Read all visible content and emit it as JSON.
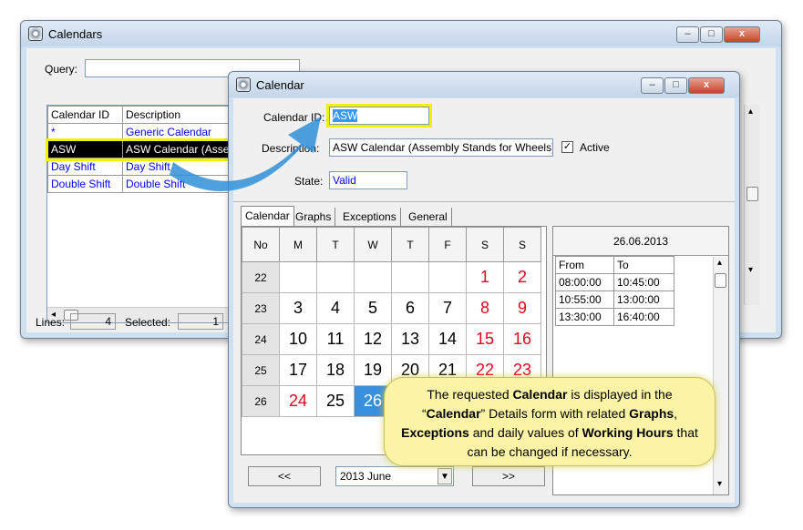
{
  "calendars_window": {
    "title": "Calendars",
    "controls": {
      "minimize": "–",
      "maximize": "□",
      "close": "x"
    },
    "query_label": "Query:",
    "query_value": "",
    "columns": [
      "Calendar ID",
      "Description"
    ],
    "rows": [
      {
        "id": "*",
        "desc": "Generic Calendar"
      },
      {
        "id": "ASW",
        "desc": "ASW Calendar (Assem"
      },
      {
        "id": "Day Shift",
        "desc": "Day Shift"
      },
      {
        "id": "Double Shift",
        "desc": "Double Shift"
      }
    ],
    "status": {
      "lines_label": "Lines:",
      "lines_value": "4",
      "selected_label": "Selected:",
      "selected_value": "1"
    }
  },
  "calendar_window": {
    "title": "Calendar",
    "controls": {
      "minimize": "–",
      "maximize": "□",
      "close": "x"
    },
    "calendar_id_label": "Calendar ID:",
    "calendar_id_value": "ASW",
    "description_label": "Description:",
    "description_value": "ASW Calendar (Assembly Stands for Wheels)",
    "active_label": "Active",
    "active_checked": true,
    "state_label": "State:",
    "state_value": "Valid",
    "tabs": [
      "Calendar",
      "Graphs",
      "Exceptions",
      "General"
    ],
    "grid_headers": [
      "No",
      "M",
      "T",
      "W",
      "T",
      "F",
      "S",
      "S"
    ],
    "weeks": [
      {
        "no": "22",
        "days": [
          "",
          "",
          "",
          "",
          "",
          "1",
          "2"
        ]
      },
      {
        "no": "23",
        "days": [
          "3",
          "4",
          "5",
          "6",
          "7",
          "8",
          "9"
        ]
      },
      {
        "no": "24",
        "days": [
          "10",
          "11",
          "12",
          "13",
          "14",
          "15",
          "16"
        ]
      },
      {
        "no": "25",
        "days": [
          "17",
          "18",
          "19",
          "20",
          "21",
          "22",
          "23"
        ]
      },
      {
        "no": "26",
        "days": [
          "24",
          "25",
          "26",
          "",
          "",
          "",
          ""
        ]
      }
    ],
    "selected_date": "26.06.2013",
    "hours_columns": [
      "From",
      "To"
    ],
    "hours": [
      {
        "from": "08:00:00",
        "to": "10:45:00"
      },
      {
        "from": "10:55:00",
        "to": "13:00:00"
      },
      {
        "from": "13:30:00",
        "to": "16:40:00"
      }
    ],
    "nav": {
      "prev": "<<",
      "month_value": "2013 June",
      "next": ">>"
    }
  },
  "callout": {
    "t1": "The requested ",
    "b1": "Calendar",
    "t2": " is displayed in the “",
    "b2": "Calendar",
    "t3": "” Details form with related ",
    "b3": "Graphs",
    "t4": ", ",
    "b4": "Exceptions",
    "t5": " and daily values of ",
    "b5": "Working Hours",
    "t6": " that can be changed if necessary."
  },
  "colors": {
    "weekend_red": "#e8001c",
    "selected_blue": "#3a8fdc",
    "highlight_yellow": "#f2f200",
    "row_selected_bg": "#000000",
    "link_blue": "#0000ff",
    "callout_bg": "#fbf4a6"
  }
}
